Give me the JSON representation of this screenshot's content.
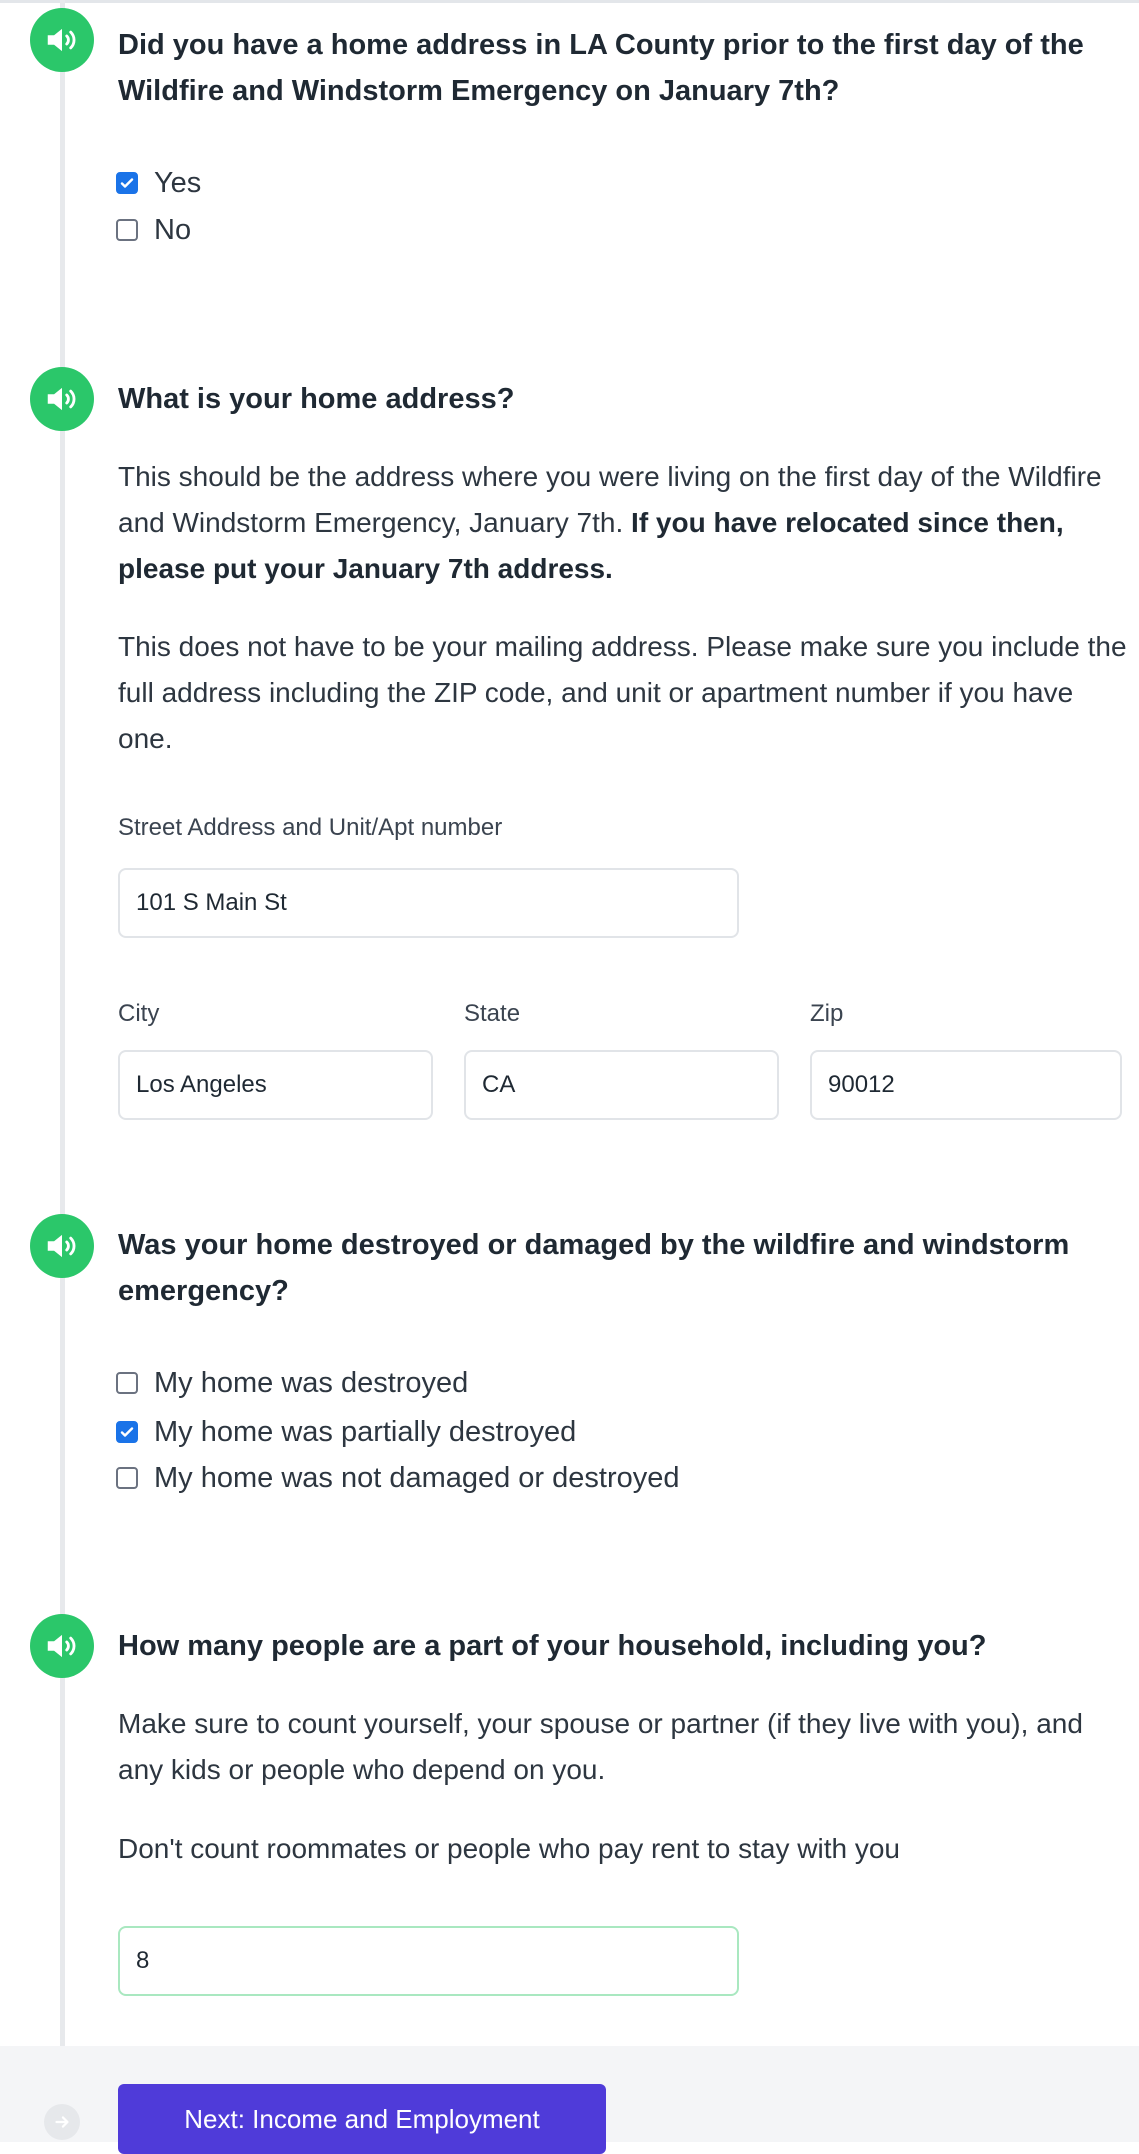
{
  "colors": {
    "accent_green": "#2bc76a",
    "button_purple": "#4f3bd9",
    "checkbox_blue": "#1a73e8"
  },
  "q1": {
    "text": "Did you have a home address in LA County prior to the first day of the Wildfire and Windstorm Emergency on January 7th?",
    "options": [
      {
        "label": "Yes",
        "checked": true
      },
      {
        "label": "No",
        "checked": false
      }
    ]
  },
  "q2": {
    "text": "What is your home address?",
    "p1_normal": "This should be the address where you were living on the first day of the Wildfire and Windstorm Emergency, January 7th. ",
    "p1_bold": "If you have relocated since then, please put your January 7th address.",
    "p2": "This does not have to be your mailing address. Please make sure you include the full address including the ZIP code, and unit or apartment number if you have one.",
    "street_label": "Street Address and Unit/Apt number",
    "street_value": "101 S Main St",
    "city_label": "City",
    "city_value": "Los Angeles",
    "state_label": "State",
    "state_value": "CA",
    "zip_label": "Zip",
    "zip_value": "90012"
  },
  "q3": {
    "text": "Was your home destroyed or damaged by the wildfire and windstorm emergency?",
    "options": [
      {
        "label": "My home was destroyed",
        "checked": false
      },
      {
        "label": "My home was partially destroyed",
        "checked": true
      },
      {
        "label": "My home was not damaged or destroyed",
        "checked": false
      }
    ]
  },
  "q4": {
    "text": "How many people are a part of your household, including you?",
    "p1": "Make sure to count yourself, your spouse or partner (if they live with you), and any kids or people who depend on you.",
    "p2": "Don't count roommates or people who pay rent to stay with you",
    "value": "8"
  },
  "footer": {
    "next_label": "Next: Income and Employment"
  }
}
